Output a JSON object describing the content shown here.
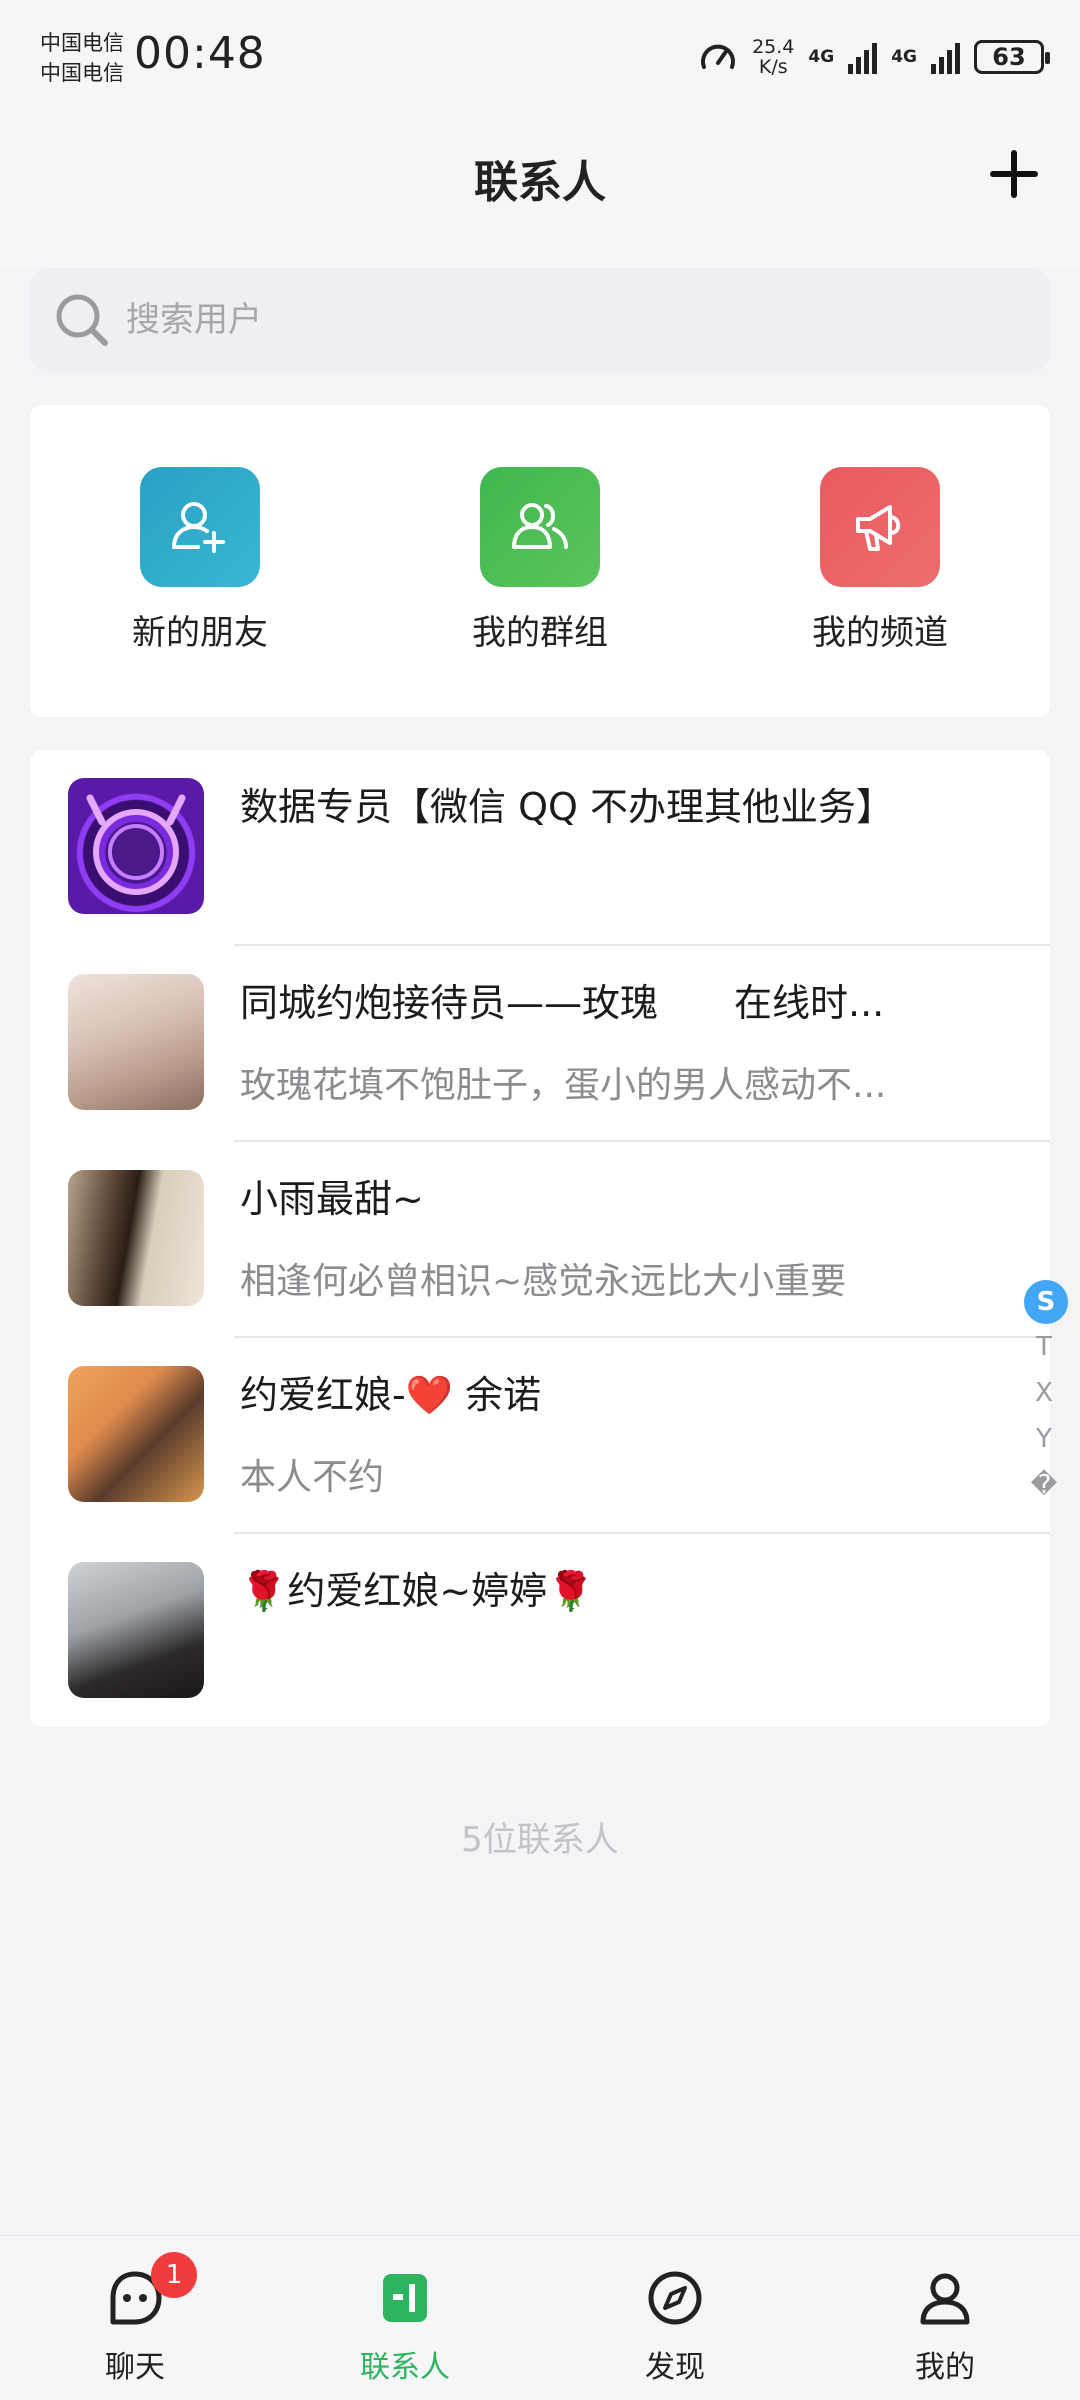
{
  "status_bar": {
    "carrier_1": "中国电信",
    "carrier_2": "中国电信",
    "time": "00:48",
    "net_speed_value": "25.4",
    "net_speed_unit": "K/s",
    "net_1": "4G",
    "net_2": "4G",
    "battery": "63"
  },
  "header": {
    "title": "联系人"
  },
  "search": {
    "placeholder": "搜索用户"
  },
  "quick_actions": [
    {
      "label": "新的朋友",
      "icon": "add-user-icon",
      "color": "#2aa0c4"
    },
    {
      "label": "我的群组",
      "icon": "group-icon",
      "color": "#3fb74e"
    },
    {
      "label": "我的频道",
      "icon": "megaphone-icon",
      "color": "#e95a5e"
    }
  ],
  "contacts": [
    {
      "name": "数据专员【微信 QQ 不办理其他业务】",
      "signature": ""
    },
    {
      "name": "同城约炮接待员——玫瑰　　在线时...",
      "signature": "玫瑰花填不饱肚子，蛋小的男人感动不..."
    },
    {
      "name": "小雨最甜~",
      "signature": "相逢何必曾相识~感觉永远比大小重要"
    },
    {
      "name": "约爱红娘-❤️ 余诺",
      "signature": "本人不约"
    },
    {
      "name": "🌹约爱红娘~婷婷🌹",
      "signature": ""
    }
  ],
  "contact_count": "5位联系人",
  "index_bar": [
    "S",
    "T",
    "X",
    "Y",
    "�"
  ],
  "bottom_nav": [
    {
      "label": "聊天",
      "badge": "1"
    },
    {
      "label": "联系人",
      "active": true
    },
    {
      "label": "发现"
    },
    {
      "label": "我的"
    }
  ],
  "colors": {
    "accent_green": "#2db55d",
    "badge_red": "#f03c3c",
    "index_active": "#42a5f5"
  }
}
